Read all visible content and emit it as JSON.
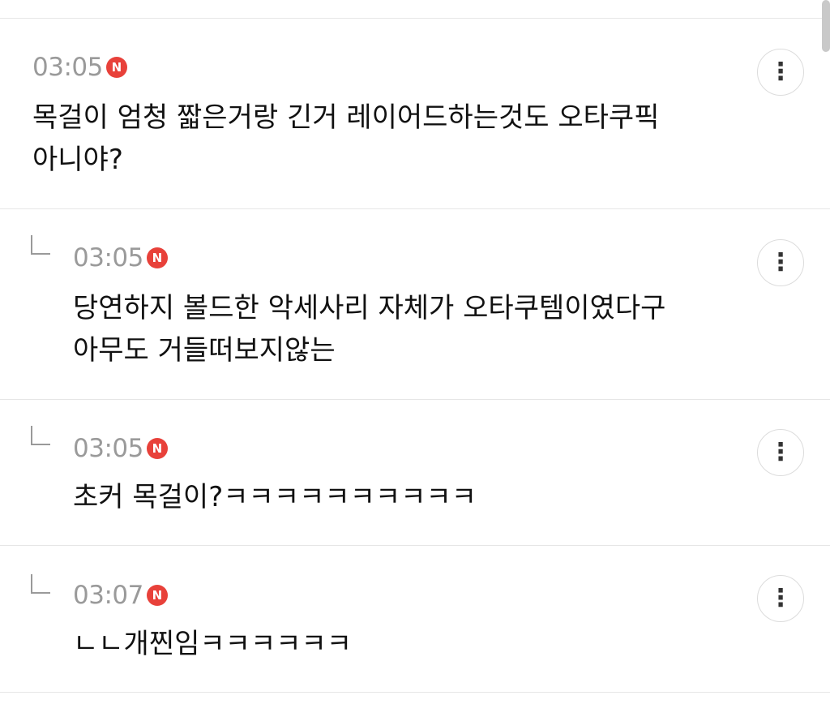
{
  "comments": [
    {
      "time": "03:05",
      "badge": "N",
      "lines": [
        "목걸이 엄청 짧은거랑 긴거 레이어드하는것도 오타쿠픽",
        "아니야?"
      ],
      "more_icon": "⋮"
    },
    {
      "time": "03:05",
      "badge": "N",
      "lines": [
        "당연하지 볼드한 악세사리 자체가 오타쿠템이였다구",
        "아무도 거들떠보지않는"
      ],
      "more_icon": "⋮"
    },
    {
      "time": "03:05",
      "badge": "N",
      "lines": [
        "초커 목걸이?ㅋㅋㅋㅋㅋㅋㅋㅋㅋㅋ"
      ],
      "more_icon": "⋮"
    },
    {
      "time": "03:07",
      "badge": "N",
      "lines": [
        "ㄴㄴ개찐임ㅋㅋㅋㅋㅋㅋ"
      ],
      "more_icon": "⋮"
    }
  ]
}
